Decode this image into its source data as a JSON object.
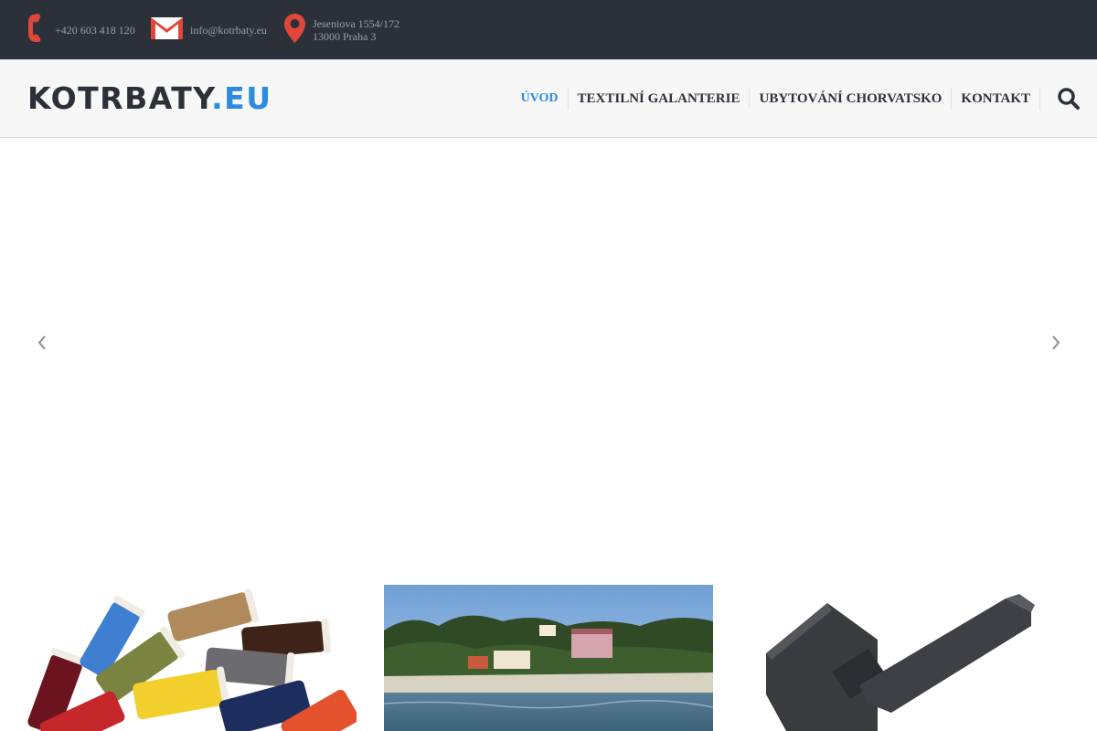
{
  "topbar": {
    "phone": "+420 603 418 120",
    "email": "info@kotrbaty.eu",
    "address_line1": "Jeseniova 1554/172",
    "address_line2": "13000 Praha 3"
  },
  "header": {
    "logo_main": "KOTRBATY",
    "logo_accent": ".EU",
    "nav": [
      {
        "label": "ÚVOD"
      },
      {
        "label": "TEXTILNÍ GALANTERIE"
      },
      {
        "label": "UBYTOVÁNÍ CHORVATSKO"
      },
      {
        "label": "KONTAKT"
      }
    ]
  },
  "colors": {
    "topbar_bg": "#2b3039",
    "accent": "#2b8be0",
    "icon_red": "#e0473a",
    "text_dark": "#2b3039"
  },
  "icons": {
    "phone": "phone-icon",
    "email": "mail-icon",
    "address": "map-pin-icon",
    "search": "search-icon",
    "prev": "chevron-left-icon",
    "next": "chevron-right-icon"
  },
  "cards": [
    {
      "image": "colorful thread spools"
    },
    {
      "image": "seaside village with beach"
    },
    {
      "image": "black door handle"
    }
  ]
}
